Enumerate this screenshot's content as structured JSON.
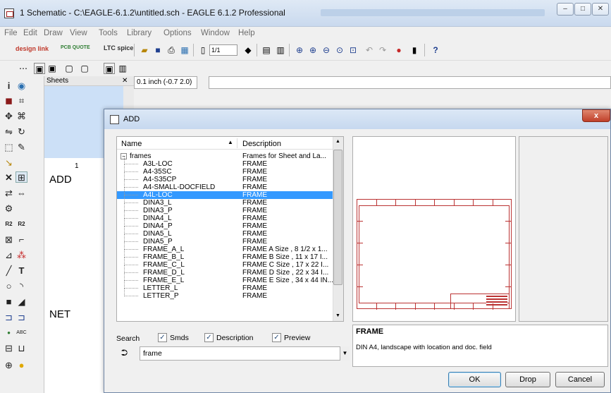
{
  "window": {
    "title": "1 Schematic - C:\\EAGLE-6.1.2\\untitled.sch - EAGLE 6.1.2 Professional",
    "caption_min": "–",
    "caption_max": "□",
    "caption_close": "✕"
  },
  "menu": [
    "File",
    "Edit",
    "Draw",
    "View",
    "Tools",
    "Library",
    "Options",
    "Window",
    "Help"
  ],
  "toolbar": {
    "design_link": "design link",
    "pcb_quote": "PCB QUOTE",
    "ltc_spice": "LTC spice",
    "sheet_select": "1/1",
    "help": "?"
  },
  "sheets_panel": {
    "header": "Sheets",
    "sheet_number": "1"
  },
  "labels": {
    "add": "ADD",
    "net": "NET"
  },
  "coordbar": {
    "coordinates": "0.1 inch (-0.7 2.0)"
  },
  "dialog": {
    "title": "ADD",
    "close": "x",
    "columns": {
      "name": "Name",
      "description": "Description"
    },
    "group": {
      "name": "frames",
      "description": "Frames for Sheet and La..."
    },
    "items": [
      {
        "name": "A3L-LOC",
        "description": "FRAME",
        "selected": false
      },
      {
        "name": "A4-35SC",
        "description": "FRAME",
        "selected": false
      },
      {
        "name": "A4-S35CP",
        "description": "FRAME",
        "selected": false
      },
      {
        "name": "A4-SMALL-DOCFIELD",
        "description": "FRAME",
        "selected": false
      },
      {
        "name": "A4L-LOC",
        "description": "FRAME",
        "selected": true
      },
      {
        "name": "DINA3_L",
        "description": "FRAME",
        "selected": false
      },
      {
        "name": "DINA3_P",
        "description": "FRAME",
        "selected": false
      },
      {
        "name": "DINA4_L",
        "description": "FRAME",
        "selected": false
      },
      {
        "name": "DINA4_P",
        "description": "FRAME",
        "selected": false
      },
      {
        "name": "DINA5_L",
        "description": "FRAME",
        "selected": false
      },
      {
        "name": "DINA5_P",
        "description": "FRAME",
        "selected": false
      },
      {
        "name": "FRAME_A_L",
        "description": "FRAME A Size , 8 1/2 x 1...",
        "selected": false
      },
      {
        "name": "FRAME_B_L",
        "description": "FRAME B Size , 11 x 17 I...",
        "selected": false
      },
      {
        "name": "FRAME_C_L",
        "description": "FRAME C Size , 17 x 22 I...",
        "selected": false
      },
      {
        "name": "FRAME_D_L",
        "description": "FRAME D Size , 22 x 34 I...",
        "selected": false
      },
      {
        "name": "FRAME_E_L",
        "description": "FRAME E Size , 34 x 44 IN...",
        "selected": false
      },
      {
        "name": "LETTER_L",
        "description": "FRAME",
        "selected": false
      },
      {
        "name": "LETTER_P",
        "description": "FRAME",
        "selected": false
      }
    ],
    "search": {
      "label": "Search",
      "smds": "Smds",
      "description": "Description",
      "preview": "Preview",
      "smds_checked": true,
      "description_checked": true,
      "preview_checked": true,
      "value": "frame"
    },
    "detail": {
      "title": "FRAME",
      "text": "DIN A4, landscape with location and doc. field"
    },
    "buttons": {
      "ok": "OK",
      "drop": "Drop",
      "cancel": "Cancel"
    }
  },
  "colors": {
    "selection": "#3399ff",
    "frame_red": "#b33333",
    "sheet_thumb": "#cce0f7"
  }
}
